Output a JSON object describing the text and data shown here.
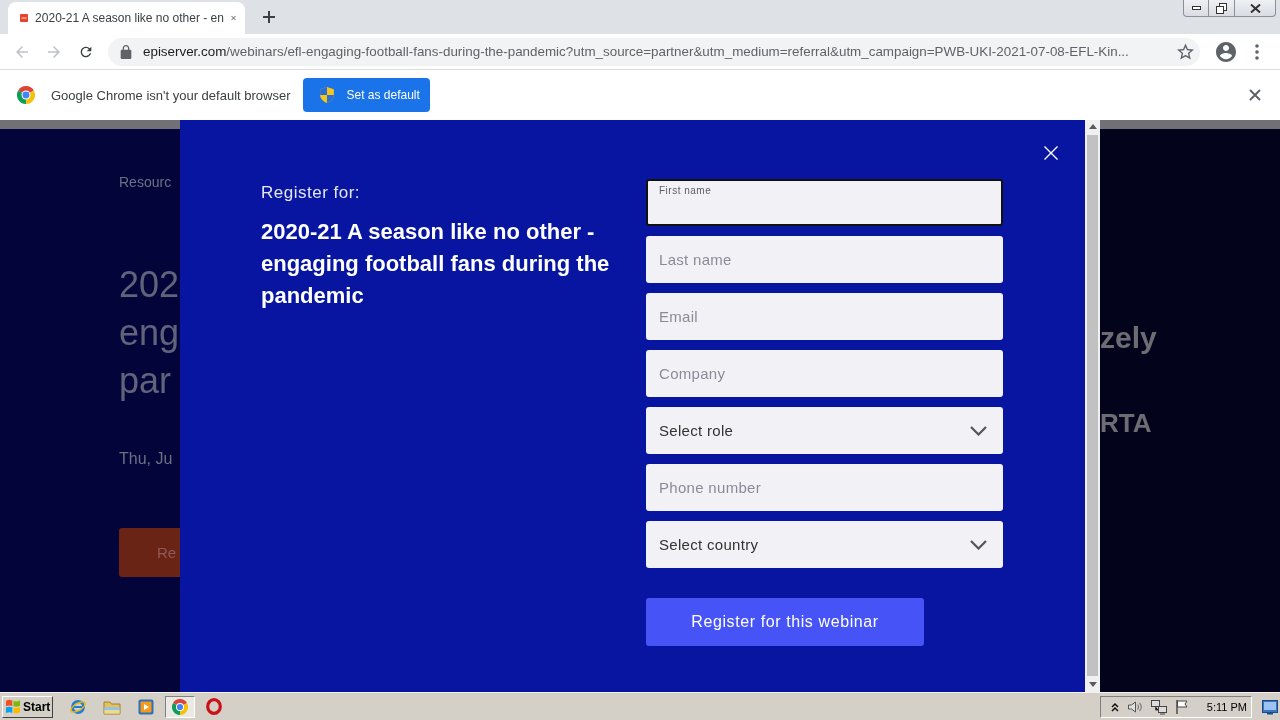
{
  "browser": {
    "tab": {
      "title": "2020-21 A season like no other - en",
      "selected": true
    },
    "nav": [
      {
        "kind": "back",
        "disabled": true
      },
      {
        "kind": "forward",
        "disabled": true
      },
      {
        "kind": "reload",
        "disabled": false
      }
    ],
    "url": {
      "host": "episerver.com",
      "path": "/webinars/efl-engaging-football-fans-during-the-pandemic?utm_source=partner&utm_medium=referral&utm_campaign=PWB-UKI-2021-07-08-EFL-Kin..."
    }
  },
  "infobar": {
    "message": "Google Chrome isn't your default browser",
    "button": "Set as default"
  },
  "background_page": {
    "breadcrumb": "Resourc",
    "heading_lines": [
      "202",
      "eng",
      "par"
    ],
    "date": "Thu, Ju",
    "button": "Re",
    "logos": [
      "zely",
      "RTA"
    ]
  },
  "modal": {
    "eyebrow": "Register for:",
    "title": "2020-21 A season like no other - engaging football fans during the pandemic",
    "fields": [
      {
        "kind": "text",
        "placeholder": "First name",
        "focused": true
      },
      {
        "kind": "text",
        "placeholder": "Last name",
        "focused": false
      },
      {
        "kind": "text",
        "placeholder": "Email",
        "focused": false
      },
      {
        "kind": "text",
        "placeholder": "Company",
        "focused": false
      },
      {
        "kind": "select",
        "value": "Select role",
        "focused": false
      },
      {
        "kind": "text",
        "placeholder": "Phone number",
        "focused": false
      },
      {
        "kind": "select",
        "value": "Select country",
        "focused": false
      }
    ],
    "submit": "Register for this webinar"
  },
  "taskbar": {
    "start": "Start",
    "apps": [
      {
        "kind": "ie",
        "selected": false
      },
      {
        "kind": "folder",
        "selected": false
      },
      {
        "kind": "player",
        "selected": false
      },
      {
        "kind": "chrome",
        "selected": true
      },
      {
        "kind": "opera",
        "selected": false
      }
    ],
    "clock": "5:11 PM"
  }
}
